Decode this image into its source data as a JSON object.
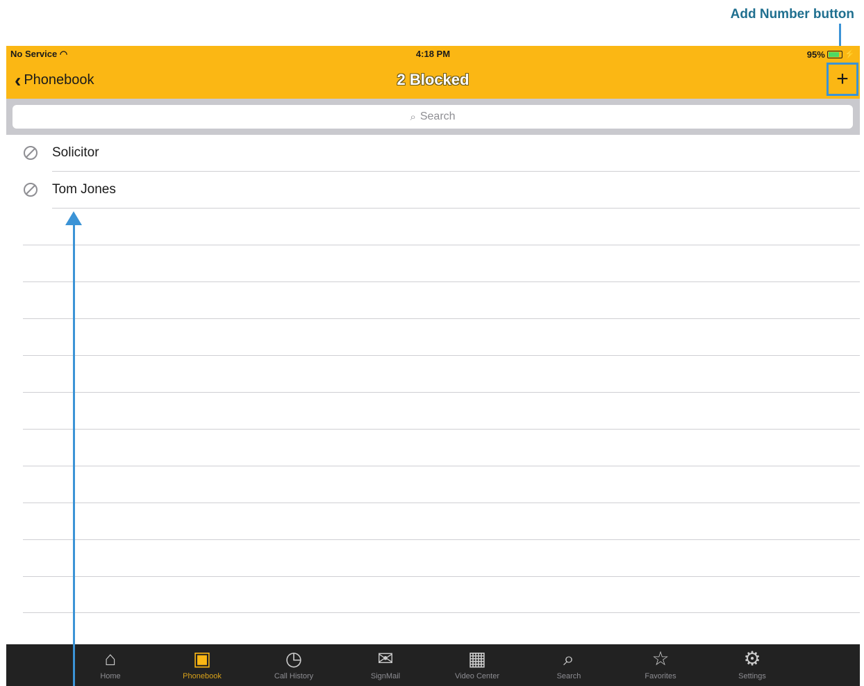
{
  "callout": {
    "add_number_label": "Add Number button"
  },
  "status": {
    "carrier": "No Service",
    "time": "4:18 PM",
    "battery": "95%"
  },
  "nav": {
    "back_label": "Phonebook",
    "title": "2 Blocked",
    "add_label": "+"
  },
  "search": {
    "placeholder": "Search"
  },
  "blocked": [
    {
      "name": "Solicitor"
    },
    {
      "name": "Tom Jones"
    }
  ],
  "tabs": [
    {
      "label": "Home",
      "icon": "home-icon"
    },
    {
      "label": "Phonebook",
      "icon": "phonebook-icon"
    },
    {
      "label": "Call History",
      "icon": "call-history-icon"
    },
    {
      "label": "SignMail",
      "icon": "signmail-icon"
    },
    {
      "label": "Video Center",
      "icon": "video-center-icon"
    },
    {
      "label": "Search",
      "icon": "search-icon"
    },
    {
      "label": "Favorites",
      "icon": "favorites-icon"
    },
    {
      "label": "Settings",
      "icon": "settings-icon"
    }
  ],
  "colors": {
    "accent": "#fbb714",
    "callout": "#3b93d6",
    "tabbar": "#222222"
  }
}
